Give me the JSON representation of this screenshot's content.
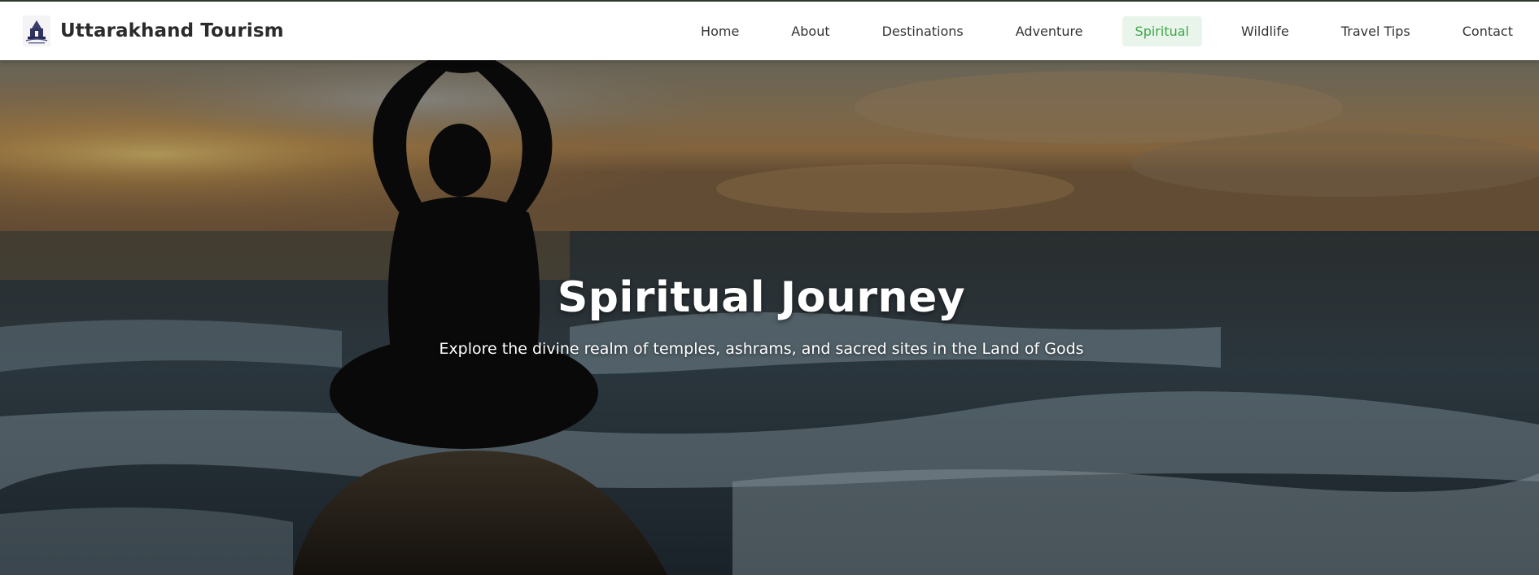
{
  "brand": {
    "name": "Uttarakhand Tourism",
    "logo_icon": "temple-logo-icon"
  },
  "nav": {
    "items": [
      {
        "label": "Home"
      },
      {
        "label": "About"
      },
      {
        "label": "Destinations"
      },
      {
        "label": "Adventure"
      },
      {
        "label": "Spiritual"
      },
      {
        "label": "Wildlife"
      },
      {
        "label": "Travel Tips"
      },
      {
        "label": "Contact"
      }
    ],
    "active": "Spiritual"
  },
  "hero": {
    "title": "Spiritual Journey",
    "subtitle": "Explore the divine realm of temples, ashrams, and sacred sites in the Land of Gods"
  },
  "colors": {
    "accent": "#3ea84a",
    "accent_bg": "#e9f5ea",
    "nav_text": "#333333",
    "brand_text": "#2b2b2b"
  }
}
